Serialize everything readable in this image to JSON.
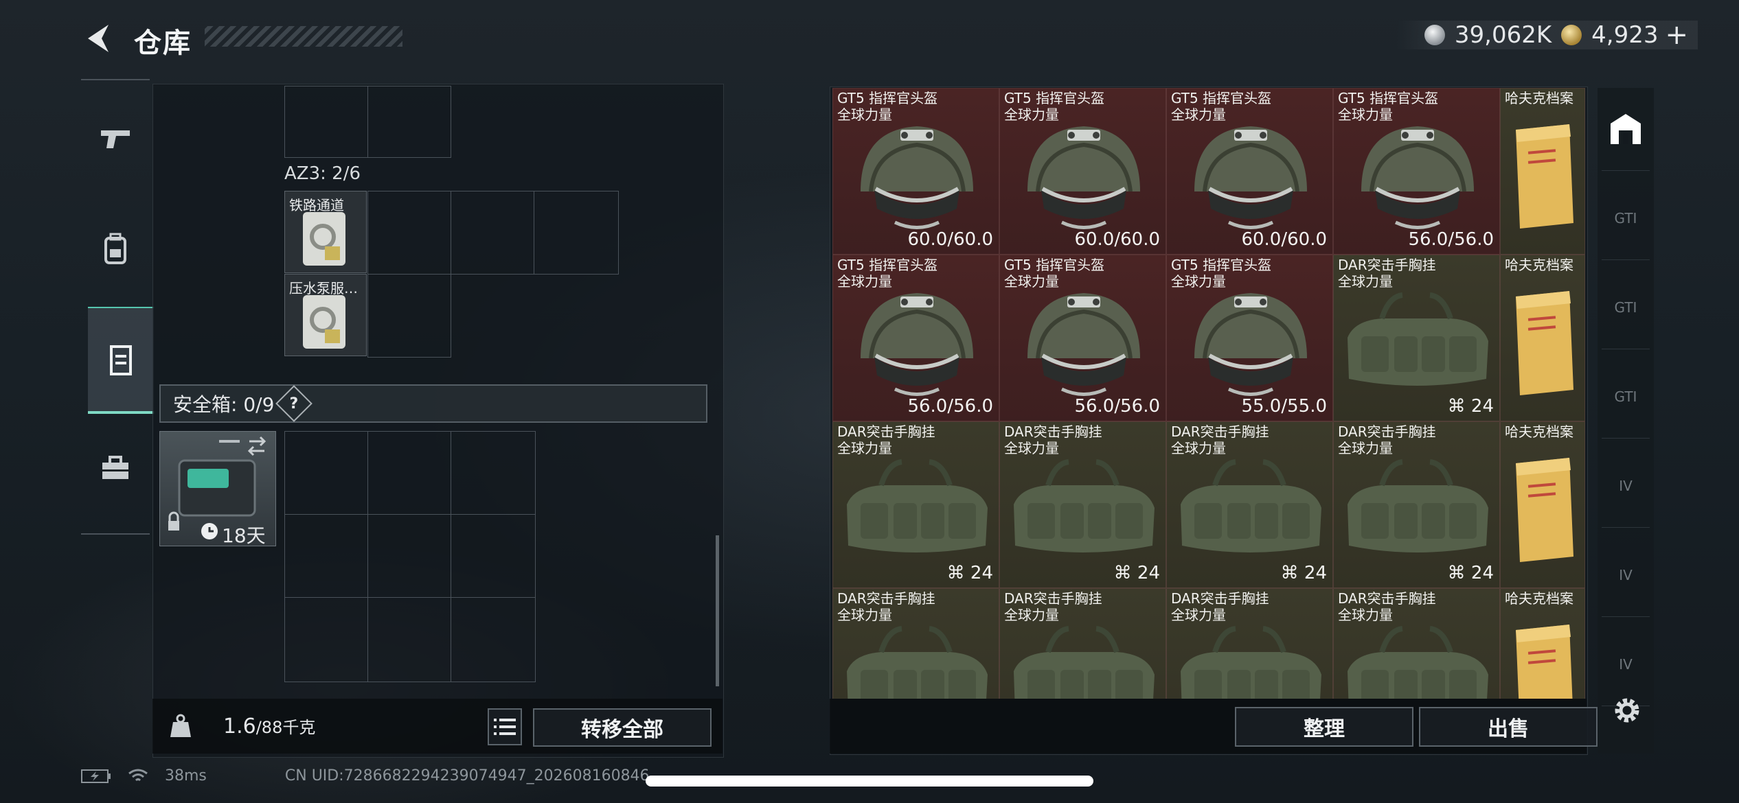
{
  "header": {
    "title": "仓库",
    "currency_silver": "39,062K",
    "currency_gold": "4,923",
    "gold_plus": "+"
  },
  "left_nav": {
    "items": [
      {
        "icon": "pistol-icon"
      },
      {
        "icon": "backpack-icon"
      },
      {
        "icon": "vest-icon",
        "active": true
      },
      {
        "icon": "toolbox-icon"
      }
    ]
  },
  "left": {
    "az3_label": "AZ3: 2/6",
    "item1_name": "铁路通道",
    "item2_name": "压水泵服…",
    "safebox_label": "安全箱: 0/9",
    "help": "?",
    "case_days": "18天",
    "weight_value": "1.6",
    "weight_unit": "/88千克",
    "transfer_all": "转移全部"
  },
  "inventory": {
    "rows": [
      [
        {
          "name1": "GT5 指挥官头盔",
          "name2": "全球力量",
          "type": "helmet",
          "value": "60.0/60.0"
        },
        {
          "name1": "GT5 指挥官头盔",
          "name2": "全球力量",
          "type": "helmet",
          "value": "60.0/60.0"
        },
        {
          "name1": "GT5 指挥官头盔",
          "name2": "全球力量",
          "type": "helmet",
          "value": "60.0/60.0"
        },
        {
          "name1": "GT5 指挥官头盔",
          "name2": "全球力量",
          "type": "helmet",
          "value": "56.0/56.0"
        },
        {
          "name1": "哈夫克档案",
          "type": "file"
        }
      ],
      [
        {
          "name1": "GT5 指挥官头盔",
          "name2": "全球力量",
          "type": "helmet",
          "value": "56.0/56.0"
        },
        {
          "name1": "GT5 指挥官头盔",
          "name2": "全球力量",
          "type": "helmet",
          "value": "56.0/56.0"
        },
        {
          "name1": "GT5 指挥官头盔",
          "name2": "全球力量",
          "type": "helmet",
          "value": "55.0/55.0"
        },
        {
          "name1": "DAR突击手胸挂",
          "name2": "全球力量",
          "type": "rig",
          "value": "24"
        },
        {
          "name1": "哈夫克档案",
          "type": "file"
        }
      ],
      [
        {
          "name1": "DAR突击手胸挂",
          "name2": "全球力量",
          "type": "rig",
          "value": "24"
        },
        {
          "name1": "DAR突击手胸挂",
          "name2": "全球力量",
          "type": "rig",
          "value": "24"
        },
        {
          "name1": "DAR突击手胸挂",
          "name2": "全球力量",
          "type": "rig",
          "value": "24"
        },
        {
          "name1": "DAR突击手胸挂",
          "name2": "全球力量",
          "type": "rig",
          "value": "24"
        },
        {
          "name1": "哈夫克档案",
          "type": "file"
        }
      ],
      [
        {
          "name1": "DAR突击手胸挂",
          "name2": "全球力量",
          "type": "rig",
          "value": ""
        },
        {
          "name1": "DAR突击手胸挂",
          "name2": "全球力量",
          "type": "rig",
          "value": ""
        },
        {
          "name1": "DAR突击手胸挂",
          "name2": "全球力量",
          "type": "rig",
          "value": ""
        },
        {
          "name1": "DAR突击手胸挂",
          "name2": "全球力量",
          "type": "rig",
          "value": ""
        },
        {
          "name1": "哈夫克档案",
          "type": "file"
        }
      ]
    ],
    "sort_label": "整理",
    "sell_label": "出售"
  },
  "side_categories": [
    "GTI",
    "GTI",
    "GTI",
    "IV",
    "IV",
    "IV"
  ],
  "status": {
    "ping": "38ms",
    "uid": "CN UID:7286682294239074947_202608160846"
  },
  "colors": {
    "accent": "#7fd9c4",
    "helmet_bg": "#4a2424",
    "rig_bg": "#3b3a2a"
  }
}
